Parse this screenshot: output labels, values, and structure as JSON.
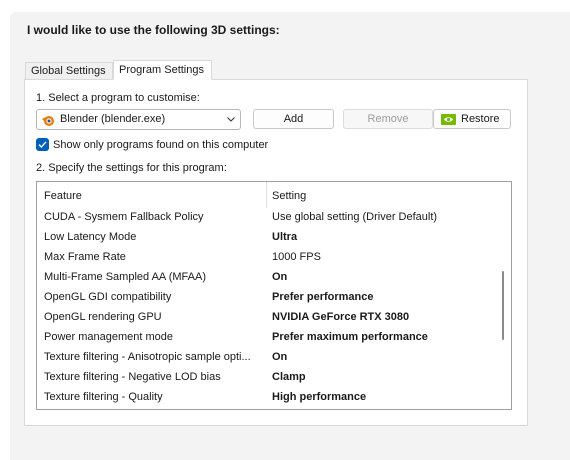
{
  "heading": "I would like to use the following 3D settings:",
  "tabs": [
    {
      "label": "Global Settings",
      "active": false
    },
    {
      "label": "Program Settings",
      "active": true
    }
  ],
  "step1_label": "1. Select a program to customise:",
  "program_select": {
    "value": "Blender (blender.exe)",
    "icon": "blender-icon"
  },
  "buttons": {
    "add": "Add",
    "remove": "Remove",
    "restore": "Restore"
  },
  "show_only_found": {
    "label": "Show only programs found on this computer",
    "checked": true
  },
  "step2_label": "2. Specify the settings for this program:",
  "table": {
    "columns": [
      "Feature",
      "Setting"
    ],
    "rows": [
      {
        "feature": "CUDA - Sysmem Fallback Policy",
        "setting": "Use global setting (Driver Default)",
        "bold": false
      },
      {
        "feature": "Low Latency Mode",
        "setting": "Ultra",
        "bold": true
      },
      {
        "feature": "Max Frame Rate",
        "setting": "1000 FPS",
        "bold": false
      },
      {
        "feature": "Multi-Frame Sampled AA (MFAA)",
        "setting": "On",
        "bold": true
      },
      {
        "feature": "OpenGL GDI compatibility",
        "setting": "Prefer performance",
        "bold": true
      },
      {
        "feature": "OpenGL rendering GPU",
        "setting": "NVIDIA GeForce RTX 3080",
        "bold": true
      },
      {
        "feature": "Power management mode",
        "setting": "Prefer maximum performance",
        "bold": true
      },
      {
        "feature": "Texture filtering - Anisotropic sample opti...",
        "setting": "On",
        "bold": true
      },
      {
        "feature": "Texture filtering - Negative LOD bias",
        "setting": "Clamp",
        "bold": true
      },
      {
        "feature": "Texture filtering - Quality",
        "setting": "High performance",
        "bold": true
      }
    ]
  },
  "colors": {
    "accent": "#005fb8",
    "nvidia_green": "#76b900",
    "blender_orange": "#e87d0d"
  }
}
